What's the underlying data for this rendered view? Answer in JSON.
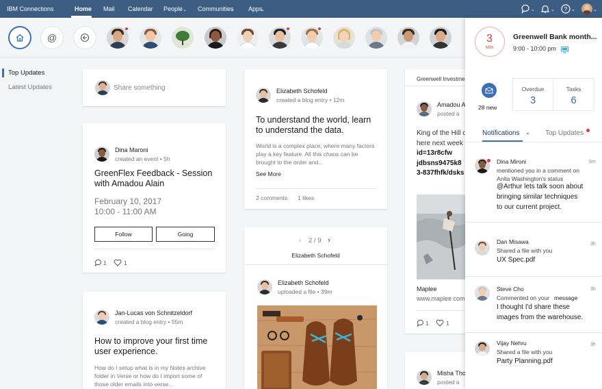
{
  "topbar": {
    "brand": "IBM Connections",
    "nav": [
      "Home",
      "Mail",
      "Calendar",
      "People",
      "Communities",
      "Apps"
    ],
    "icons": [
      "chat-icon",
      "bell-icon",
      "help-icon",
      "user-avatar"
    ]
  },
  "leftnav": {
    "items": [
      "Top Updates",
      "Latest Updates"
    ]
  },
  "share": {
    "placeholder": "Share something"
  },
  "card_event": {
    "author": "Dina Maroni",
    "action": "created an event • 5h",
    "title": "GreenFlex Feedback - Session with Amadou Alain",
    "date": "February 10, 2017",
    "time": "10:00 - 11:00 AM",
    "follow": "Follow",
    "going": "Going",
    "comments": "1",
    "likes": "1"
  },
  "card_blog1": {
    "author": "Elizabeth Schofeld",
    "action": "created a blog entry • 12m",
    "title": "To understand the world, learn to understand the data.",
    "body": "World is a complex place, where many factors play a key feature. All this chaos can be brought to the order and...",
    "see_more": "See More",
    "comments": "2 comments",
    "likes": "1 likes"
  },
  "card_blog2": {
    "author": "Jan-Lucas von Schnitzeldorf",
    "action": "created a blog entry • 55m",
    "title": "How to improve your first time user experience.",
    "body": "How do I setup what is in my Notes archive folder in Verse or how do I import some of those older emails into verse..."
  },
  "card_gallery": {
    "pager": "2 / 9",
    "heading": "Elizabeth Schofeld",
    "author": "Elizabeth Schofeld",
    "action": "uploaded a file • 39m"
  },
  "card_right": {
    "header": "Greenwell Investme",
    "author": "Amadou A",
    "action": "posted a",
    "text1": "King of the Hill o",
    "text2": "here next week",
    "code1": "id=13r8cfw",
    "code2": "jdbsns9475k8",
    "code3": "3-837fhfk/dsks",
    "link_name": "Maplee",
    "link_url": "www.maplee.com",
    "comments": "1",
    "likes": "1"
  },
  "card_bottom_right": {
    "author": "Misha Tho",
    "action": "posted a"
  },
  "panel": {
    "meeting_mins": "3",
    "meeting_unit": "MIN",
    "meeting_title": "Greenwell Bank month...",
    "meeting_time": "9:00 - 10:00 pm",
    "new_count": "28 new",
    "overdue_label": "Overdue",
    "overdue_value": "3",
    "tasks_label": "Tasks",
    "tasks_value": "6",
    "tab_notifications": "Notifications",
    "tab_top_updates": "Top Updates",
    "notifications": [
      {
        "name": "Dina Mironi",
        "time": "5m",
        "line1": "mentioned you in a comment on",
        "line2": "Anita Washington's status",
        "big1": "@Arthur lets talk soon about",
        "big2": "bringing similar techniques",
        "big3": "to our current project."
      },
      {
        "name": "Dan Misawa",
        "time": "3h",
        "line1": "Shared a file with you",
        "big1": "UX Spec.pdf"
      },
      {
        "name": "Steve Cho",
        "time": "3h",
        "line1a": "Commented on your",
        "line1b": "message",
        "big1": "I thought I'd share these",
        "big2": "images from the warehouse."
      },
      {
        "name": "Vijay Nehru",
        "time": "3h",
        "line1": "Shared a file with you",
        "big1": "Party Planning.pdf"
      }
    ]
  },
  "colors": {
    "nav": "#3b5d82",
    "accent": "#3b6fb6",
    "alert": "#e0383e"
  }
}
